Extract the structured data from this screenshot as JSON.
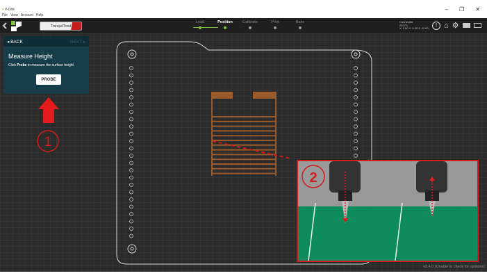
{
  "window": {
    "title": "V-One",
    "menu": [
      "File",
      "View",
      "Account",
      "Help"
    ],
    "controls": [
      "–",
      "❐",
      "✕"
    ]
  },
  "toolbar": {
    "profile_name": "TranquilTrout",
    "steps": [
      {
        "label": "Load",
        "done": true
      },
      {
        "label": "Position",
        "done": true,
        "active": true
      },
      {
        "label": "Calibrate",
        "done": false
      },
      {
        "label": "Print",
        "done": false
      },
      {
        "label": "Bake",
        "done": false
      }
    ],
    "status": {
      "connection": "Connected",
      "temperature": "26.5°C",
      "position": "X: 0.00 Y: 0.00 Z: 11.00"
    }
  },
  "panel": {
    "back_label": "BACK",
    "next_label": "NEXT",
    "title": "Measure Height",
    "desc_prefix": "Click ",
    "desc_bold": "Probe",
    "desc_suffix": " to measure the surface height",
    "probe_label": "PROBE"
  },
  "annotations": {
    "one": "1",
    "two": "2"
  },
  "version": "v3.4.0 (Unable to check for updates)",
  "colors": {
    "accent": "#7fc241",
    "panel": "#163d4a",
    "annotation": "#d41b1b",
    "trace": "#9a5a2a"
  }
}
